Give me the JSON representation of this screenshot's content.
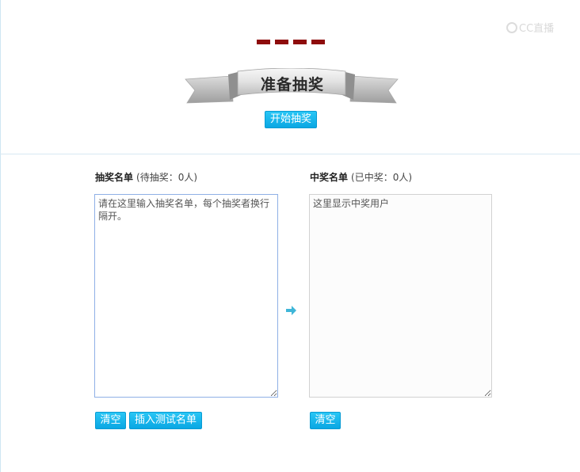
{
  "watermark": {
    "text": "CC直播"
  },
  "banner": {
    "title": "准备抽奖"
  },
  "start_button": {
    "label": "开始抽奖"
  },
  "entries": {
    "title": "抽奖名单",
    "status": "(待抽奖：0人)",
    "placeholder": "请在这里输入抽奖名单，每个抽奖者换行隔开。",
    "clear_label": "清空",
    "insert_test_label": "插入测试名单"
  },
  "winners": {
    "title": "中奖名单",
    "status": "(已中奖：0人)",
    "placeholder": "这里显示中奖用户",
    "clear_label": "清空"
  },
  "colors": {
    "accent": "#0aa7e3",
    "dashes": "#8e0c0c",
    "arrow": "#3fb6d8"
  },
  "icons": {
    "arrow": "arrow-right-icon",
    "banner": "ribbon-banner"
  }
}
